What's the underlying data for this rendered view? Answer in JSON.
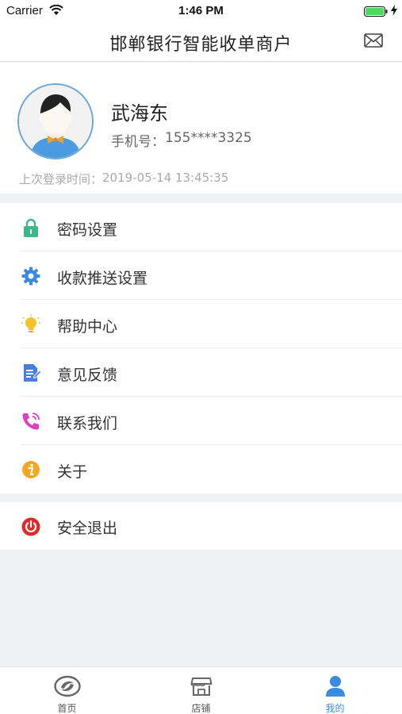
{
  "status_bar": {
    "carrier": "Carrier",
    "time": "1:46 PM"
  },
  "nav": {
    "title": "邯郸银行智能收单商户",
    "right_icon": "mail-icon"
  },
  "profile": {
    "name": "武海东",
    "phone_label": "手机号：",
    "phone_value": "155****3325",
    "last_login_label": "上次登录时间：",
    "last_login_value": "2019-05-14 13:45:35"
  },
  "menu": {
    "items": [
      {
        "label": "密码设置",
        "icon": "lock-icon",
        "color": "#3db88a"
      },
      {
        "label": "收款推送设置",
        "icon": "gear-icon",
        "color": "#3a8be0"
      },
      {
        "label": "帮助中心",
        "icon": "lightbulb-icon",
        "color": "#f5c22a"
      },
      {
        "label": "意见反馈",
        "icon": "feedback-doc-icon",
        "color": "#4a7de0"
      },
      {
        "label": "联系我们",
        "icon": "phone-icon",
        "color": "#e040c0"
      },
      {
        "label": "关于",
        "icon": "info-icon",
        "color": "#f5a623"
      }
    ]
  },
  "logout": {
    "label": "安全退出",
    "icon": "power-icon",
    "color": "#e02a2a"
  },
  "tab_bar": {
    "tabs": [
      {
        "label": "首页",
        "icon": "bank-logo-icon",
        "active": false
      },
      {
        "label": "店铺",
        "icon": "store-icon",
        "active": false
      },
      {
        "label": "我的",
        "icon": "user-icon",
        "active": true
      }
    ],
    "active_color": "#3a8be0"
  }
}
